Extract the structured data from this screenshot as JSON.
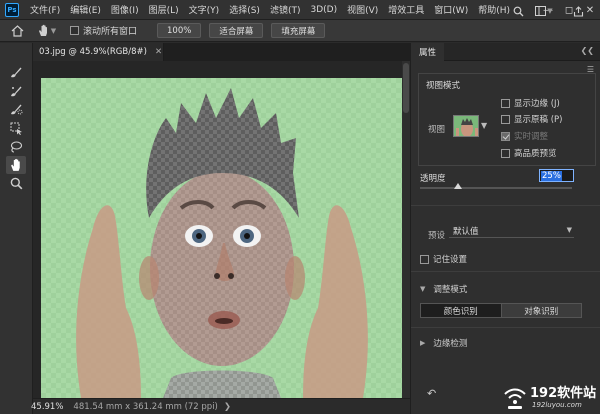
{
  "menu": {
    "logo": "Ps",
    "items": [
      "文件(F)",
      "编辑(E)",
      "图像(I)",
      "图层(L)",
      "文字(Y)",
      "选择(S)",
      "滤镜(T)",
      "3D(D)",
      "视图(V)",
      "增效工具",
      "窗口(W)",
      "帮助(H)"
    ]
  },
  "options": {
    "scroll_all_label": "滚动所有窗口",
    "zoom_btn": "100%",
    "fit_btn": "适合屏幕",
    "fill_btn": "填充屏幕"
  },
  "document": {
    "tab_title": "03.jpg @ 45.9%(RGB/8#)",
    "status_zoom": "45.91%",
    "status_size": "481.54 mm x 361.24 mm (72 ppi)"
  },
  "panel": {
    "tab": "属性",
    "view_mode_title": "视图模式",
    "view_label": "视图",
    "show_edges": "显示边缘 (J)",
    "show_original": "显示原稿 (P)",
    "realtime": "实时调整",
    "hq_preview": "高品质预览",
    "opacity_label": "透明度",
    "opacity_value": "25%",
    "opacity_fraction": 0.25,
    "preset_label": "预设",
    "preset_value": "默认值",
    "remember_label": "记住设置",
    "adjust_mode": "调整模式",
    "color_recog": "颜色识别",
    "object_recog": "对象识别",
    "edge_detect": "边缘检测"
  },
  "watermark": {
    "main": "192软件站",
    "sub": "192luyou.com"
  }
}
